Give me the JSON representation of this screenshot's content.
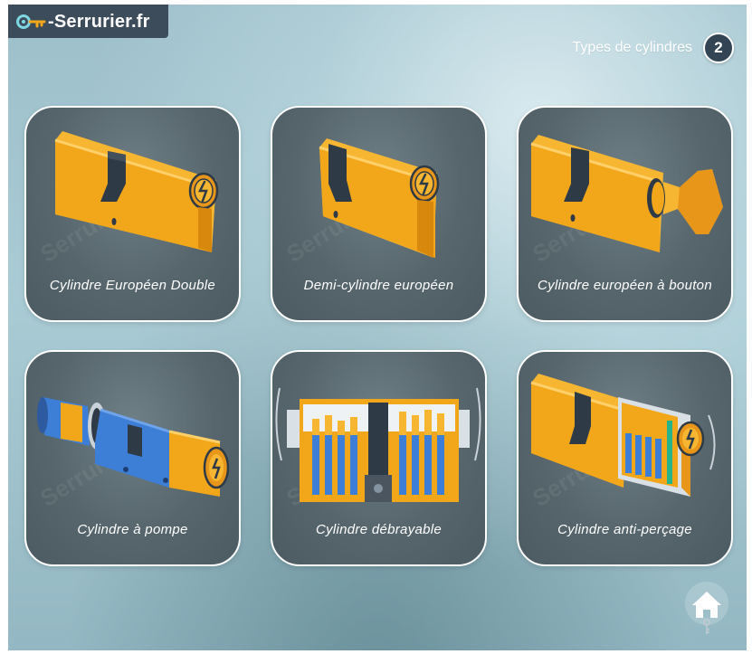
{
  "brand": {
    "logo_text": "-Serrurier.fr",
    "watermark": "Serrurier"
  },
  "header": {
    "title": "Types de cylindres",
    "page_number": "2"
  },
  "cards": [
    {
      "label": "Cylindre Européen Double",
      "icon": "double-cylinder-icon"
    },
    {
      "label": "Demi-cylindre européen",
      "icon": "half-cylinder-icon"
    },
    {
      "label": "Cylindre européen à bouton",
      "icon": "knob-cylinder-icon"
    },
    {
      "label": "Cylindre à pompe",
      "icon": "pump-cylinder-icon"
    },
    {
      "label": "Cylindre débrayable",
      "icon": "clutch-cylinder-icon"
    },
    {
      "label": "Cylindre anti-perçage",
      "icon": "anti-drill-cylinder-icon"
    }
  ],
  "home_button": {
    "icon": "home-key-icon"
  },
  "colors": {
    "cylinder_gold": "#f2a71b",
    "cylinder_shadow": "#d8890d",
    "cam_dark": "#2e3a45",
    "pin_blue": "#3d7fd6",
    "card_bg": "#56666c",
    "badge_bg": "#334554"
  }
}
